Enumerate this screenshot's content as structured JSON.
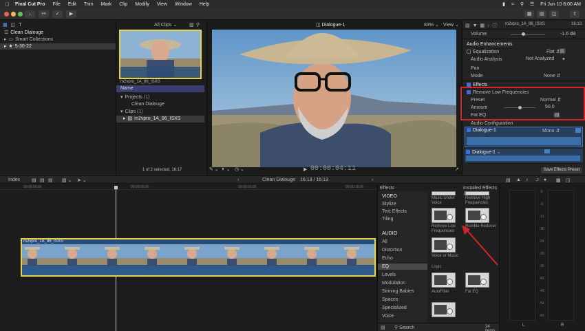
{
  "menubar": {
    "app": "Final Cut Pro",
    "items": [
      "File",
      "Edit",
      "Trim",
      "Mark",
      "Clip",
      "Modify",
      "View",
      "Window",
      "Help"
    ],
    "clock": "Fri Jun 10  8:00 AM"
  },
  "browser": {
    "library": "Clean Dialouge",
    "smart_collections": "Smart Collections",
    "event": "5-30-22",
    "filter": "All Clips",
    "thumb_caption": "m2vpro_1A_86_ISXS",
    "column": "Name",
    "projects": "Projects",
    "projects_count": "(1)",
    "project_item": "Clean Dialouge",
    "clips": "Clips",
    "clips_count": "(1)",
    "clip_item": "m2vpro_1A_86_ISXS",
    "status": "1 of 2 selected, 16:17"
  },
  "viewer": {
    "title": "Dialogue-1",
    "zoom": "83%",
    "view_menu": "View",
    "timecode": "00:00:04:11"
  },
  "inspector": {
    "clip_name": "m2vpro_1A_86_ISXS",
    "duration": "16:13",
    "volume_label": "Volume",
    "volume_value": "-1.6 dB",
    "audio_enh": "Audio Enhancements",
    "equalization": "Equalization",
    "eq_value": "Flat",
    "audio_analysis": "Audio Analysis",
    "analysis_value": "Not Analyzed",
    "pan": "Pan",
    "mode": "Mode",
    "mode_value": "None",
    "effects": "Effects",
    "effect_name": "Remove Low Frequencies",
    "preset": "Preset",
    "preset_value": "Normal",
    "amount": "Amount",
    "amount_value": "50.0",
    "amount_fraction": 0.5,
    "fat_eq": "Fat EQ",
    "audio_config": "Audio Configuration",
    "role1": "Dialogue-1",
    "role1_mode": "Mono",
    "role2": "Dialogue-1",
    "save_preset": "Save Effects Preset"
  },
  "timeline": {
    "index": "Index",
    "project": "Clean Dialouge",
    "duration": "16:13 / 16:13",
    "clip_label": "m2vpro_1A_86_ISXS",
    "ruler": [
      "00:00:00:00",
      "00:00:05:00",
      "00:00:10:00",
      "00:00:15:00"
    ]
  },
  "effects": {
    "title": "Effects",
    "installed": "Installed Effects",
    "categories": [
      "VIDEO",
      "Stylize",
      "Text Effects",
      "Tiling",
      "AUDIO",
      "All",
      "Distortion",
      "Echo",
      "EQ",
      "Levels",
      "Modulation",
      "Sinning Babies",
      "Spaces",
      "Specialized",
      "Voice"
    ],
    "selected": "EQ",
    "items": [
      "Music Under Voice",
      "Remove High Frequencies",
      "Remove Low Frequencies",
      "Rumble Reducer",
      "Voice or Music"
    ],
    "section_logic": "Logic",
    "logic_items": [
      "AutoFilter",
      "Fat EQ"
    ],
    "search": "Search",
    "count": "24 items"
  },
  "meters": {
    "scale": [
      "0",
      "-6",
      "-12",
      "-18",
      "-24",
      "-30",
      "-36",
      "-42",
      "-48",
      "-54",
      "-60"
    ],
    "left": "L",
    "right": "R"
  },
  "colors": {
    "accent": "#3f6fd8",
    "highlight_box": "#d8232a",
    "clip_border": "#e7d349",
    "waveform": "#2a4d78"
  }
}
